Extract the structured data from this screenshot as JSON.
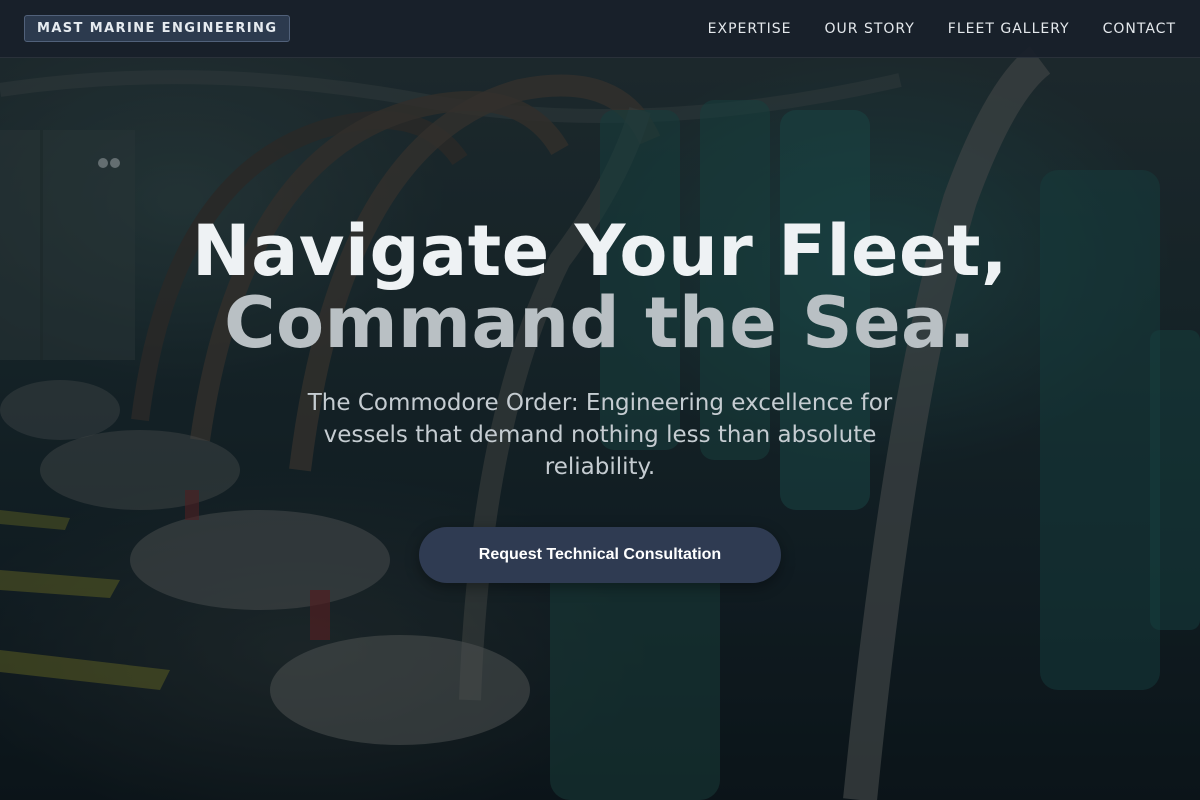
{
  "header": {
    "brand": "MAST MARINE ENGINEERING",
    "nav": [
      "EXPERTISE",
      "OUR STORY",
      "FLEET GALLERY",
      "CONTACT"
    ]
  },
  "hero": {
    "headline_line1": "Navigate Your Fleet,",
    "headline_line2": "Command the Sea.",
    "subtitle": "The Commodore Order: Engineering excellence for vessels that demand nothing less than absolute reliability.",
    "cta_label": "Request Technical Consultation",
    "background_image": "engine-room-photo"
  },
  "colors": {
    "header_bg": "#18202a",
    "brand_badge_bg": "#2c3a4e",
    "cta_bg": "#2f3b52",
    "headline_primary": "#eef2f4",
    "headline_secondary": "#b9c0c4"
  }
}
